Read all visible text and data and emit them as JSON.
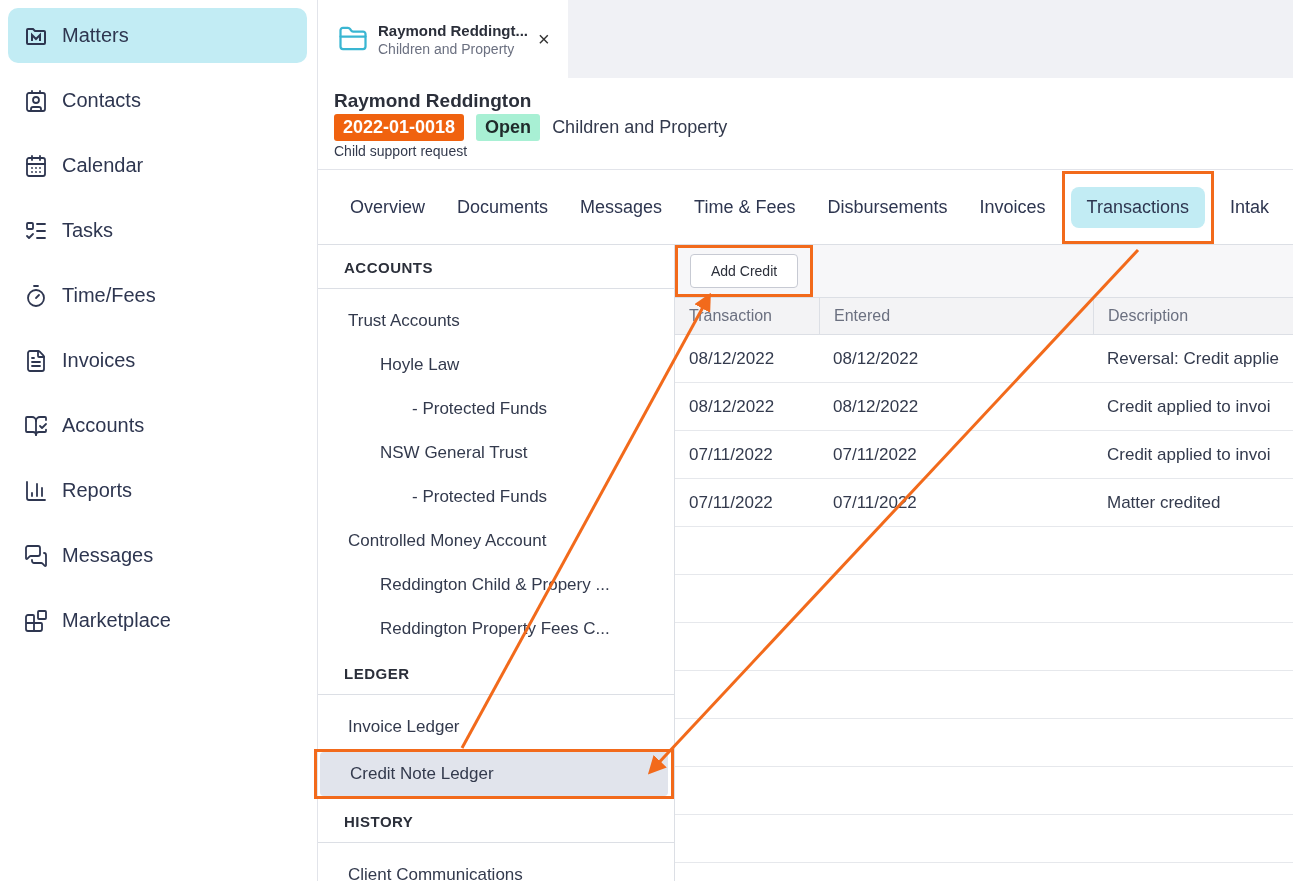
{
  "sidebar": {
    "items": [
      {
        "label": "Matters",
        "selected": true
      },
      {
        "label": "Contacts",
        "selected": false
      },
      {
        "label": "Calendar",
        "selected": false
      },
      {
        "label": "Tasks",
        "selected": false
      },
      {
        "label": "Time/Fees",
        "selected": false
      },
      {
        "label": "Invoices",
        "selected": false
      },
      {
        "label": "Accounts",
        "selected": false
      },
      {
        "label": "Reports",
        "selected": false
      },
      {
        "label": "Messages",
        "selected": false
      },
      {
        "label": "Marketplace",
        "selected": false
      }
    ]
  },
  "open_tab": {
    "title": "Raymond Reddingt...",
    "subtitle": "Children and Property",
    "close": "×"
  },
  "matter": {
    "client": "Raymond Reddington",
    "number": "2022-01-0018",
    "status": "Open",
    "type": "Children and Property",
    "description": "Child support request"
  },
  "tabs": [
    {
      "label": "Overview",
      "selected": false,
      "highlighted": false
    },
    {
      "label": "Documents",
      "selected": false,
      "highlighted": false
    },
    {
      "label": "Messages",
      "selected": false,
      "highlighted": false
    },
    {
      "label": "Time & Fees",
      "selected": false,
      "highlighted": false
    },
    {
      "label": "Disbursements",
      "selected": false,
      "highlighted": false
    },
    {
      "label": "Invoices",
      "selected": false,
      "highlighted": false
    },
    {
      "label": "Transactions",
      "selected": true,
      "highlighted": true
    },
    {
      "label": "Intak",
      "selected": false,
      "highlighted": false
    }
  ],
  "accounts_panel": {
    "sections": [
      {
        "heading": "ACCOUNTS",
        "items": [
          {
            "label": "Trust Accounts",
            "selected": false,
            "children": [
              {
                "label": "Hoyle Law",
                "selected": false,
                "children": [
                  {
                    "label": "- Protected Funds",
                    "selected": false
                  }
                ]
              },
              {
                "label": "NSW General Trust",
                "selected": false,
                "children": [
                  {
                    "label": "- Protected Funds",
                    "selected": false
                  }
                ]
              }
            ]
          },
          {
            "label": "Controlled Money Account",
            "selected": false,
            "children": [
              {
                "label": "Reddington Child & Propery ...",
                "selected": false
              },
              {
                "label": "Reddington Property Fees C...",
                "selected": false
              }
            ]
          }
        ]
      },
      {
        "heading": "LEDGER",
        "items": [
          {
            "label": "Invoice Ledger",
            "selected": false,
            "highlighted": false
          },
          {
            "label": "Credit Note Ledger",
            "selected": true,
            "highlighted": true
          }
        ]
      },
      {
        "heading": "HISTORY",
        "items": [
          {
            "label": "Client Communications",
            "selected": false
          }
        ]
      }
    ]
  },
  "toolbar": {
    "add_credit": {
      "label": "Add Credit",
      "highlighted": true
    }
  },
  "table": {
    "columns": [
      "Transaction",
      "Entered",
      "Description"
    ],
    "rows": [
      [
        "08/12/2022",
        "08/12/2022",
        "Reversal: Credit applie"
      ],
      [
        "08/12/2022",
        "08/12/2022",
        "Credit applied to invoi"
      ],
      [
        "07/11/2022",
        "07/11/2022",
        "Credit applied to invoi"
      ],
      [
        "07/11/2022",
        "07/11/2022",
        "Matter credited"
      ]
    ]
  }
}
